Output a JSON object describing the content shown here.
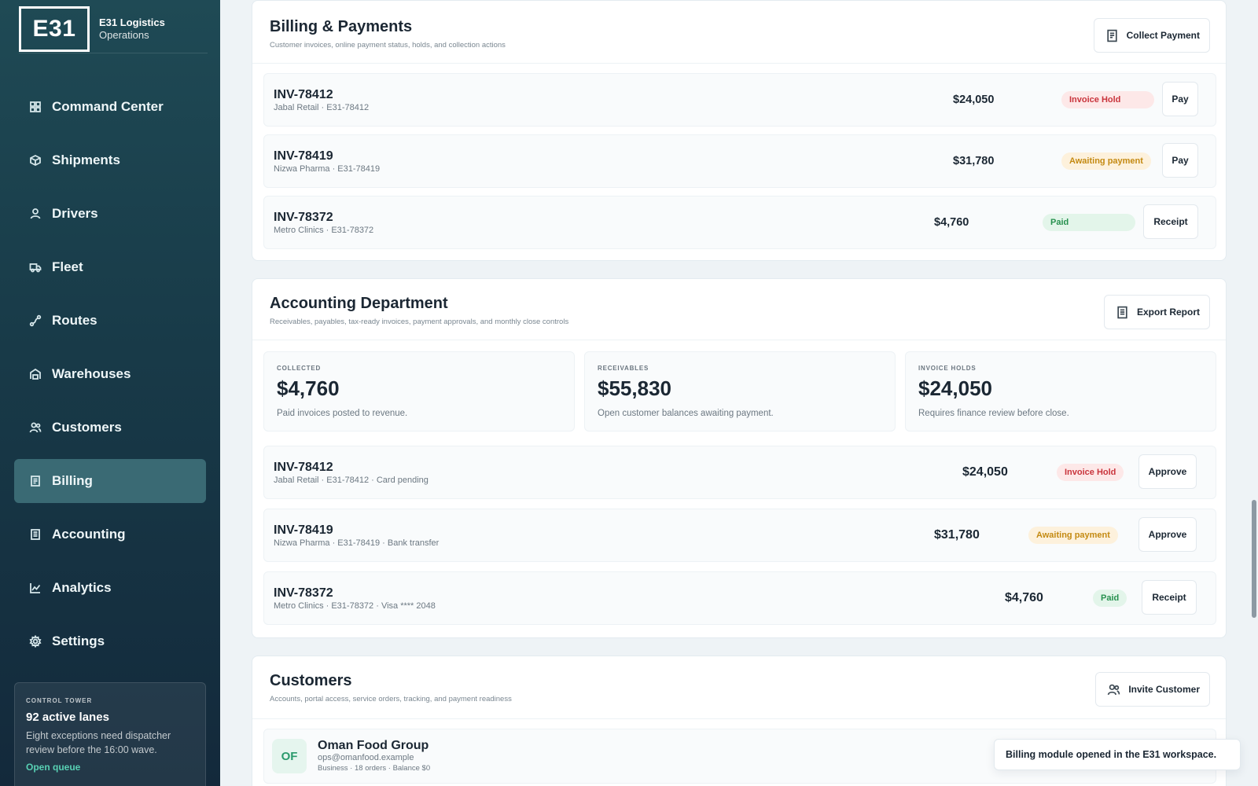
{
  "brand": {
    "logo": "E31",
    "name": "E31 Logistics",
    "subtitle": "Operations"
  },
  "nav": [
    {
      "label": "Command Center",
      "icon": "grid-icon"
    },
    {
      "label": "Shipments",
      "icon": "box-icon"
    },
    {
      "label": "Drivers",
      "icon": "person-icon"
    },
    {
      "label": "Fleet",
      "icon": "truck-icon"
    },
    {
      "label": "Routes",
      "icon": "route-icon"
    },
    {
      "label": "Warehouses",
      "icon": "warehouse-icon"
    },
    {
      "label": "Customers",
      "icon": "users-icon"
    },
    {
      "label": "Billing",
      "icon": "receipt-icon",
      "active": true
    },
    {
      "label": "Accounting",
      "icon": "ledger-icon"
    },
    {
      "label": "Analytics",
      "icon": "chart-icon"
    },
    {
      "label": "Settings",
      "icon": "gear-icon"
    }
  ],
  "control_tower": {
    "kicker": "CONTROL TOWER",
    "title": "92 active lanes",
    "description": "Eight exceptions need dispatcher review before the 16:00 wave.",
    "link": "Open queue"
  },
  "billing": {
    "title": "Billing & Payments",
    "subtitle": "Customer invoices, online payment status, holds, and collection actions",
    "action": "Collect Payment",
    "rows": [
      {
        "id": "INV-78412",
        "meta": "Jabal Retail · E31-78412",
        "amount": "$24,050",
        "status": "Invoice Hold",
        "action": "Pay"
      },
      {
        "id": "INV-78419",
        "meta": "Nizwa Pharma · E31-78419",
        "amount": "$31,780",
        "status": "Awaiting payment",
        "action": "Pay"
      },
      {
        "id": "INV-78372",
        "meta": "Metro Clinics · E31-78372",
        "amount": "$4,760",
        "status": "Paid",
        "action": "Receipt"
      }
    ]
  },
  "accounting": {
    "title": "Accounting Department",
    "subtitle": "Receivables, payables, tax-ready invoices, payment approvals, and monthly close controls",
    "action": "Export Report",
    "kpis": [
      {
        "label": "COLLECTED",
        "value": "$4,760",
        "note": "Paid invoices posted to revenue."
      },
      {
        "label": "RECEIVABLES",
        "value": "$55,830",
        "note": "Open customer balances awaiting payment."
      },
      {
        "label": "INVOICE HOLDS",
        "value": "$24,050",
        "note": "Requires finance review before close."
      }
    ],
    "rows": [
      {
        "id": "INV-78412",
        "meta": "Jabal Retail · E31-78412 · Card pending",
        "amount": "$24,050",
        "status": "Invoice Hold",
        "action": "Approve"
      },
      {
        "id": "INV-78419",
        "meta": "Nizwa Pharma · E31-78419 · Bank transfer",
        "amount": "$31,780",
        "status": "Awaiting payment",
        "action": "Approve"
      },
      {
        "id": "INV-78372",
        "meta": "Metro Clinics · E31-78372 · Visa **** 2048",
        "amount": "$4,760",
        "status": "Paid",
        "action": "Receipt"
      }
    ]
  },
  "customers": {
    "title": "Customers",
    "subtitle": "Accounts, portal access, service orders, tracking, and payment readiness",
    "action": "Invite Customer",
    "rows": [
      {
        "initials": "OF",
        "name": "Oman Food Group",
        "email": "ops@omanfood.example",
        "meta": "Business · 18 orders · Balance $0"
      }
    ]
  },
  "toast": "Billing module opened in the E31 workspace.",
  "colors": {
    "accent": "#3a6a74",
    "hold": "#c9343c",
    "await": "#c48a12",
    "paid": "#27914f",
    "link": "#58d1b4"
  }
}
